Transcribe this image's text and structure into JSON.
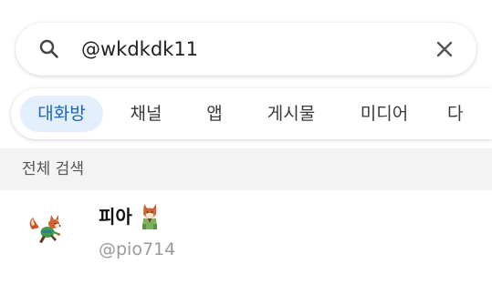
{
  "search": {
    "value": "@wkdkdk11",
    "icon": "search-icon",
    "clear_icon": "close-icon"
  },
  "tabs": [
    {
      "label": "대화방",
      "active": true
    },
    {
      "label": "채널",
      "active": false
    },
    {
      "label": "앱",
      "active": false
    },
    {
      "label": "게시물",
      "active": false
    },
    {
      "label": "미디어",
      "active": false
    },
    {
      "label": "다",
      "active": false
    }
  ],
  "section": {
    "title": "전체 검색"
  },
  "results": [
    {
      "name": "피아",
      "handle": "@pio714",
      "avatar_icon": "fox-character-icon",
      "name_emoji_icon": "fox-emoji-icon"
    }
  ],
  "colors": {
    "active_tab_bg": "#e3effc",
    "active_tab_text": "#1a63c4",
    "section_bg": "#f3f3f3",
    "handle_text": "#9a9a9a"
  }
}
